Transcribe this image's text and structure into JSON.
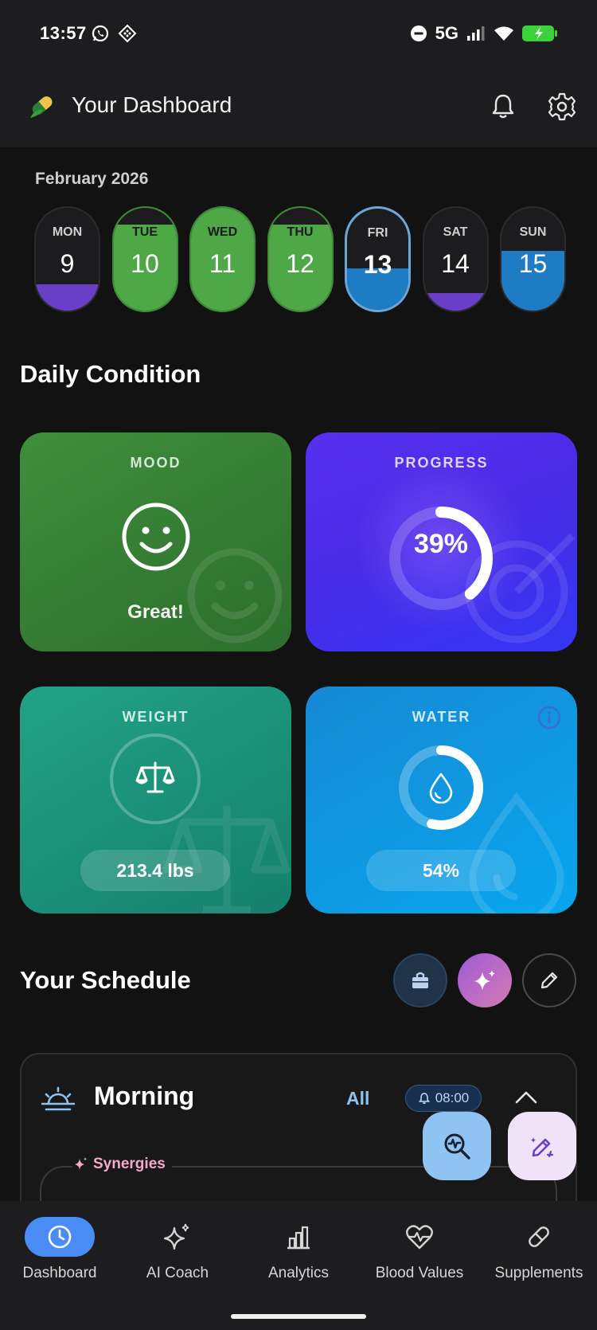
{
  "status_bar": {
    "time": "13:57",
    "network": "5G"
  },
  "header": {
    "title": "Your Dashboard"
  },
  "calendar": {
    "month": "February 2026",
    "days": [
      {
        "name": "MON",
        "num": "9"
      },
      {
        "name": "TUE",
        "num": "10"
      },
      {
        "name": "WED",
        "num": "11"
      },
      {
        "name": "THU",
        "num": "12"
      },
      {
        "name": "FRI",
        "num": "13"
      },
      {
        "name": "SAT",
        "num": "14"
      },
      {
        "name": "SUN",
        "num": "15"
      }
    ],
    "selected": "FRI"
  },
  "daily_condition": {
    "title": "Daily Condition",
    "mood": {
      "label": "MOOD",
      "value": "Great!"
    },
    "progress": {
      "label": "PROGRESS",
      "value": "39%",
      "fraction": 0.39
    },
    "weight": {
      "label": "WEIGHT",
      "value": "213.4 lbs"
    },
    "water": {
      "label": "WATER",
      "value": "54%",
      "fraction": 0.54
    }
  },
  "schedule": {
    "title": "Your Schedule",
    "morning": {
      "title": "Morning",
      "all_label": "All",
      "time": "08:00"
    },
    "synergies_label": "Synergies"
  },
  "nav": {
    "items": [
      {
        "label": "Dashboard"
      },
      {
        "label": "AI Coach"
      },
      {
        "label": "Analytics"
      },
      {
        "label": "Blood Values"
      },
      {
        "label": "Supplements"
      }
    ],
    "active": "Dashboard"
  },
  "colors": {
    "accent": "#4a8cf5",
    "mood_card": "#3e8f3c",
    "progress_card": "#5630f0",
    "weight_card": "#21a287",
    "water_card": "#08a6ee",
    "day_green": "#4ea845",
    "day_blue": "#1d7cc4",
    "day_purple": "#6a3fc8"
  }
}
